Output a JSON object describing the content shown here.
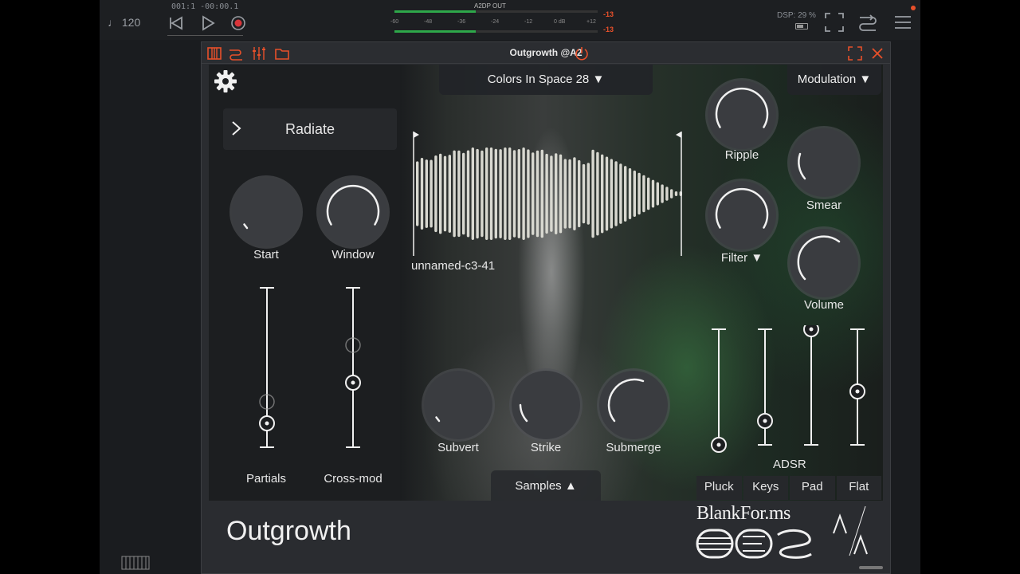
{
  "host": {
    "tempo": "♩ 120",
    "position": "001:1 -00:00.1",
    "meter_title": "A2DP OUT",
    "meter_scale": [
      "-60",
      "-48",
      "-36",
      "-24",
      "-12",
      "0 dB",
      "+12"
    ],
    "meter_peak_top": "-13",
    "meter_peak_bottom": "-13",
    "dsp": "DSP: 29 %"
  },
  "plugin": {
    "title": "Outgrowth @A2",
    "preset_category": "Colors In Space 28 ▼",
    "modulation": "Modulation ▼",
    "preset_name": "Radiate",
    "sample_name": "unnamed-c3-41",
    "samples_button": "Samples ▲",
    "knobs": {
      "start": "Start",
      "window": "Window",
      "ripple": "Ripple",
      "smear": "Smear",
      "filter": "Filter ▼",
      "volume": "Volume",
      "subvert": "Subvert",
      "strike": "Strike",
      "submerge": "Submerge"
    },
    "sliders": {
      "partials": "Partials",
      "crossmod": "Cross-mod"
    },
    "adsr": {
      "label": "ADSR",
      "tabs": [
        "Pluck",
        "Keys",
        "Pad",
        "Flat"
      ]
    },
    "product_name": "Outgrowth",
    "brand_name": "BlankFor.ms"
  },
  "colors": {
    "accent": "#e8502a",
    "meter_green": "#2ea84a",
    "text": "#e8e8e8",
    "panel": "#2a2c30"
  }
}
